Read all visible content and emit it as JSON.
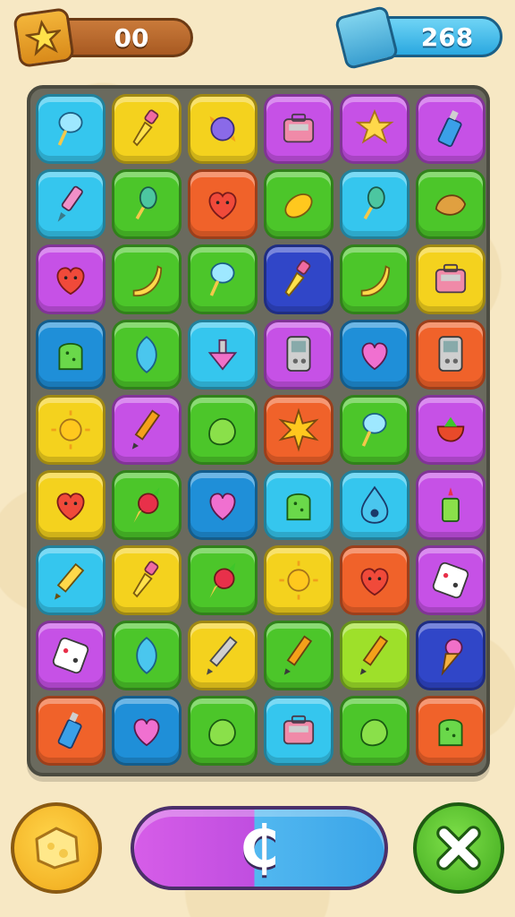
{
  "hud": {
    "score": "00",
    "coins": "268",
    "score_icon": "star-icon",
    "coins_icon": "gem-icon"
  },
  "board": {
    "rows": [
      [
        {
          "color": "#35c6ee",
          "icon": "cotton-candy"
        },
        {
          "color": "#f4d21e",
          "icon": "dropper"
        },
        {
          "color": "#f4d21e",
          "icon": "candy-ball"
        },
        {
          "color": "#c651e6",
          "icon": "toolbox"
        },
        {
          "color": "#c651e6",
          "icon": "star"
        },
        {
          "color": "#c651e6",
          "icon": "bottle"
        }
      ],
      [
        {
          "color": "#35c6ee",
          "icon": "marker"
        },
        {
          "color": "#4cc62a",
          "icon": "ice-pop"
        },
        {
          "color": "#f0622a",
          "icon": "heart-face"
        },
        {
          "color": "#4cc62a",
          "icon": "mango"
        },
        {
          "color": "#35c6ee",
          "icon": "ice-pop"
        },
        {
          "color": "#4cc62a",
          "icon": "croissant"
        }
      ],
      [
        {
          "color": "#c651e6",
          "icon": "heart-face"
        },
        {
          "color": "#4cc62a",
          "icon": "banana"
        },
        {
          "color": "#4cc62a",
          "icon": "cotton-candy"
        },
        {
          "color": "#3046c8",
          "icon": "dropper"
        },
        {
          "color": "#4cc62a",
          "icon": "banana"
        },
        {
          "color": "#f4d21e",
          "icon": "toolbox"
        }
      ],
      [
        {
          "color": "#1f8fd8",
          "icon": "gummy"
        },
        {
          "color": "#4cc62a",
          "icon": "balloon"
        },
        {
          "color": "#35c6ee",
          "icon": "spinning-top"
        },
        {
          "color": "#c651e6",
          "icon": "game-console"
        },
        {
          "color": "#1f8fd8",
          "icon": "heart"
        },
        {
          "color": "#f0622a",
          "icon": "game-console"
        }
      ],
      [
        {
          "color": "#f4d21e",
          "icon": "sun"
        },
        {
          "color": "#c651e6",
          "icon": "pencil"
        },
        {
          "color": "#4cc62a",
          "icon": "blob"
        },
        {
          "color": "#f0622a",
          "icon": "star-burst"
        },
        {
          "color": "#4cc62a",
          "icon": "cotton-candy"
        },
        {
          "color": "#c651e6",
          "icon": "strawberry"
        }
      ],
      [
        {
          "color": "#f4d21e",
          "icon": "heart-face"
        },
        {
          "color": "#4cc62a",
          "icon": "radish"
        },
        {
          "color": "#1f8fd8",
          "icon": "heart"
        },
        {
          "color": "#35c6ee",
          "icon": "gummy"
        },
        {
          "color": "#35c6ee",
          "icon": "drop"
        },
        {
          "color": "#c651e6",
          "icon": "candle"
        }
      ],
      [
        {
          "color": "#35c6ee",
          "icon": "crayon"
        },
        {
          "color": "#f4d21e",
          "icon": "dropper"
        },
        {
          "color": "#4cc62a",
          "icon": "radish"
        },
        {
          "color": "#f4d21e",
          "icon": "sun"
        },
        {
          "color": "#f0622a",
          "icon": "heart-face"
        },
        {
          "color": "#c651e6",
          "icon": "dice"
        }
      ],
      [
        {
          "color": "#c651e6",
          "icon": "dice"
        },
        {
          "color": "#4cc62a",
          "icon": "balloon"
        },
        {
          "color": "#f4d21e",
          "icon": "silver-pen"
        },
        {
          "color": "#4cc62a",
          "icon": "pencil"
        },
        {
          "color": "#9ee02a",
          "icon": "pencil"
        },
        {
          "color": "#3046c8",
          "icon": "ice-cream"
        }
      ],
      [
        {
          "color": "#f0622a",
          "icon": "bottle"
        },
        {
          "color": "#1f8fd8",
          "icon": "heart"
        },
        {
          "color": "#4cc62a",
          "icon": "blob"
        },
        {
          "color": "#35c6ee",
          "icon": "toolbox"
        },
        {
          "color": "#4cc62a",
          "icon": "blob"
        },
        {
          "color": "#f0622a",
          "icon": "gummy"
        }
      ]
    ]
  },
  "controls": {
    "left_icon": "cheese-icon",
    "main_label": "₵",
    "right_icon": "close-icon"
  }
}
